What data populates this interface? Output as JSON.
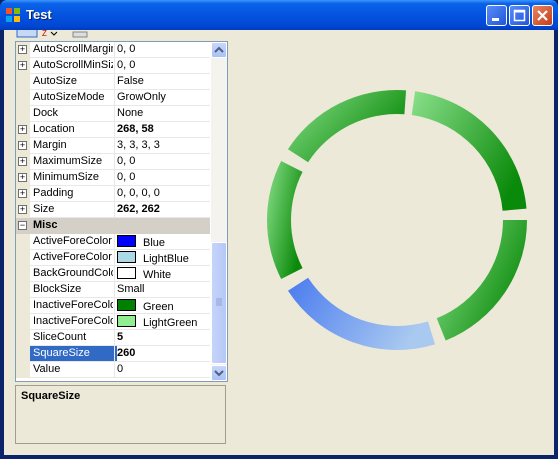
{
  "window": {
    "title": "Test"
  },
  "grid": {
    "rows": [
      {
        "name": "AutoScrollMargin",
        "value": "0, 0",
        "expandable": true,
        "bold": false
      },
      {
        "name": "AutoScrollMinSize",
        "value": "0, 0",
        "expandable": true,
        "bold": false
      },
      {
        "name": "AutoSize",
        "value": "False",
        "expandable": false,
        "bold": false
      },
      {
        "name": "AutoSizeMode",
        "value": "GrowOnly",
        "expandable": false,
        "bold": false
      },
      {
        "name": "Dock",
        "value": "None",
        "expandable": false,
        "bold": false
      },
      {
        "name": "Location",
        "value": "268, 58",
        "expandable": true,
        "bold": true
      },
      {
        "name": "Margin",
        "value": "3, 3, 3, 3",
        "expandable": true,
        "bold": false
      },
      {
        "name": "MaximumSize",
        "value": "0, 0",
        "expandable": true,
        "bold": false
      },
      {
        "name": "MinimumSize",
        "value": "0, 0",
        "expandable": true,
        "bold": false
      },
      {
        "name": "Padding",
        "value": "0, 0, 0, 0",
        "expandable": true,
        "bold": false
      },
      {
        "name": "Size",
        "value": "262, 262",
        "expandable": true,
        "bold": true
      }
    ],
    "category": "Misc",
    "misc_rows": [
      {
        "name": "ActiveForeColor",
        "value": "Blue",
        "swatch": "#0000FF",
        "bold": false
      },
      {
        "name": "ActiveForeColor",
        "value": "LightBlue",
        "swatch": "#ADD8E6",
        "bold": false
      },
      {
        "name": "BackGroundColor",
        "value": "White",
        "swatch": "#FFFFFF",
        "bold": false
      },
      {
        "name": "BlockSize",
        "value": "Small",
        "swatch": null,
        "bold": false
      },
      {
        "name": "InactiveForeColor",
        "value": "Green",
        "swatch": "#008000",
        "bold": false
      },
      {
        "name": "InactiveForeColor",
        "value": "LightGreen",
        "swatch": "#90EE90",
        "bold": false
      },
      {
        "name": "SliceCount",
        "value": "5",
        "swatch": null,
        "bold": true
      },
      {
        "name": "SquareSize",
        "value": "260",
        "swatch": null,
        "bold": true,
        "selected": true
      },
      {
        "name": "Value",
        "value": "0",
        "swatch": null,
        "bold": false
      }
    ]
  },
  "help": {
    "title": "SquareSize"
  },
  "ring": {
    "slice_count": 5,
    "active_from": "#4A7BEF",
    "active_to": "#A9C9F0",
    "inactive_from": "#8BE08B",
    "inactive_to": "#0A8A0A"
  }
}
